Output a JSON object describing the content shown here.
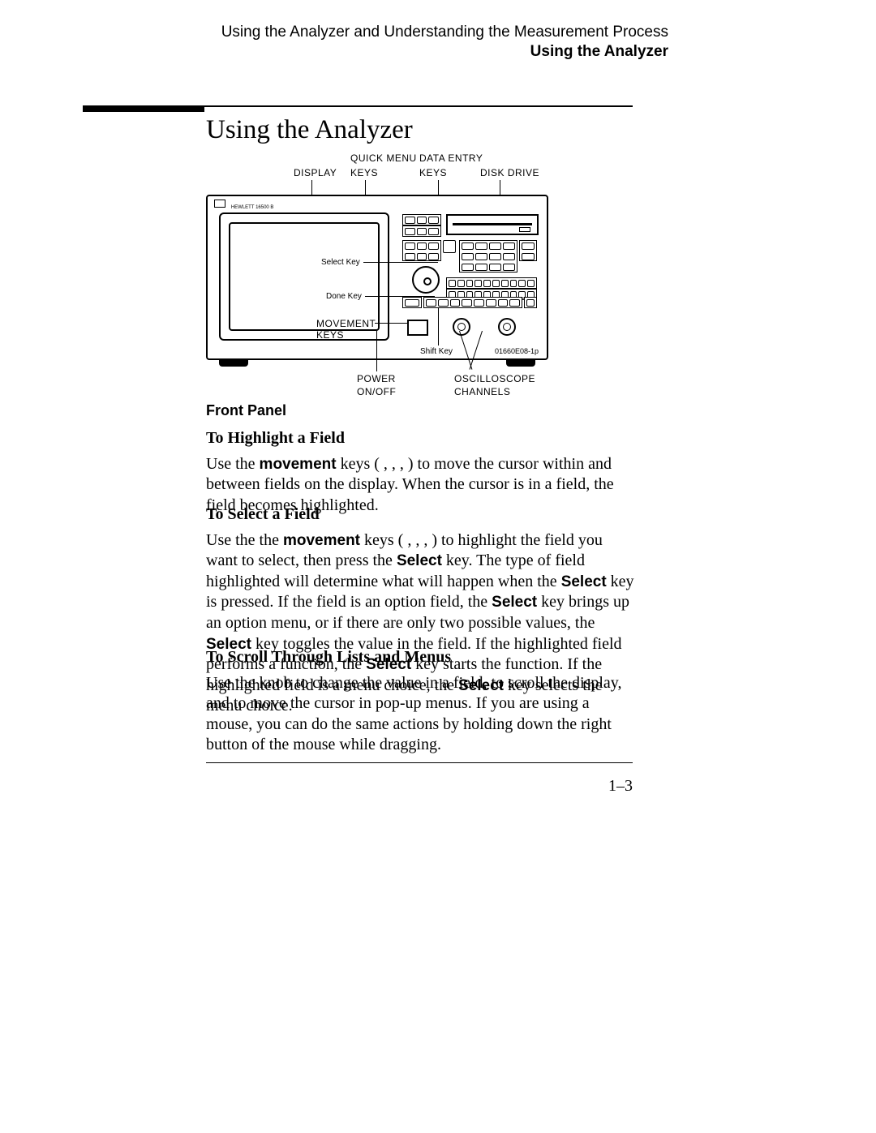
{
  "header": {
    "chapter": "Using the Analyzer and Understanding the Measurement Process",
    "section": "Using the Analyzer"
  },
  "title": "Using the Analyzer",
  "figure": {
    "top": {
      "display": "DISPLAY",
      "quick_menu": "QUICK MENU",
      "keys": "KEYS",
      "data_entry": "DATA ENTRY",
      "disk_drive": "DISK DRIVE"
    },
    "inner": {
      "select_key": "Select Key",
      "done_key": "Done Key",
      "movement": "MOVEMENT",
      "movement_keys": "KEYS",
      "shift_key": "Shift Key",
      "part_id": "01660E08-1p"
    },
    "bottom": {
      "power": "POWER",
      "onoff": "ON/OFF",
      "osc": "OSCILLOSCOPE",
      "channels": "CHANNELS"
    },
    "caption": "Front Panel"
  },
  "sections": {
    "highlight": {
      "heading": "To Highlight a Field",
      "p_before": "Use the ",
      "kw_move": "movement",
      "p_mid": " keys (  ,   ,   ,        ) to move the cursor within and between fields on the display.  When the cursor is in a field, the field becomes highlighted."
    },
    "select": {
      "heading": "To Select a Field",
      "p1a": "Use the the ",
      "kw_move": "movement",
      "p1b": " keys (  ,   ,   ,        ) to highlight the field you want to select, then press the ",
      "kw_sel1": "Select",
      "p1c": " key.  The type of field highlighted will determine what will happen when the ",
      "kw_sel2": "Select",
      "p1d": " key is pressed.  If the field is an option field, the ",
      "kw_sel3": "Select",
      "p1e": " key brings up an option menu, or if there are only two possible values, the ",
      "kw_sel4": "Select",
      "p1f": " key toggles the value in the field.  If the highlighted field performs a function, the ",
      "kw_sel5": "Select",
      "p1g": " key starts the function.  If the highlighted field is a menu choice, the ",
      "kw_sel6": "Select",
      "p1h": " key selects the menu choice."
    },
    "scroll": {
      "heading": "To Scroll Through Lists and Menus",
      "p": "Use the knob to change the value in a field, to scroll the display, and to move the cursor in pop-up menus.  If you are using a mouse, you can do the same actions by holding down the right button of the mouse while dragging."
    }
  },
  "page_number": "1–3"
}
